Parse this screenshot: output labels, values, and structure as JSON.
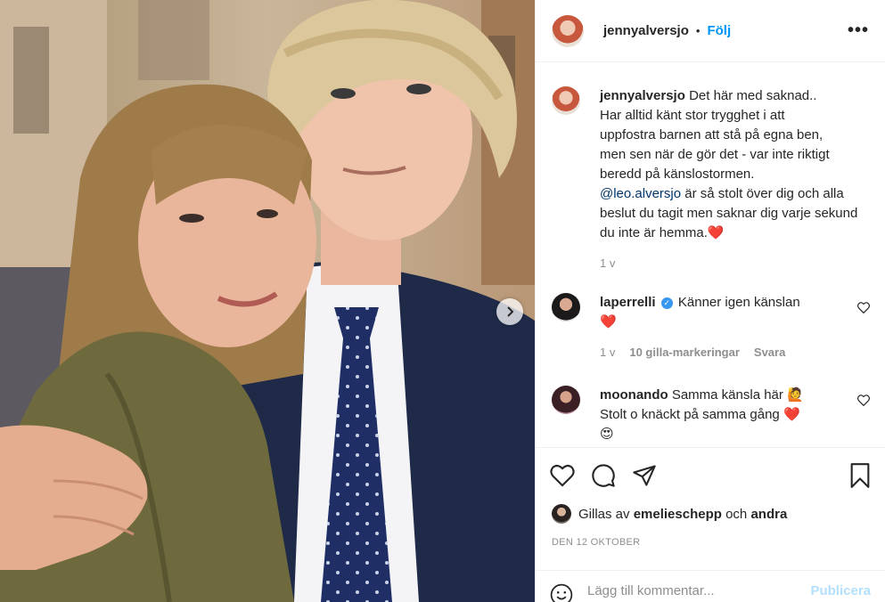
{
  "post": {
    "username": "jennyalversjo",
    "separator": "•",
    "follow_label": "Följ",
    "more_label": "•••",
    "caption_lines": [
      "Det här med saknad..",
      "Har alltid känt stor trygghet i att",
      "uppfostra barnen att stå på egna ben,",
      "men sen när de gör det - var inte riktigt",
      "beredd på känslostormen."
    ],
    "mention": "@leo.alversjo",
    "caption_after_mention": " är så stolt över dig och alla beslut du tagit men saknar dig varje sekund du inte är hemma.❤️",
    "time": "1 v"
  },
  "comments": [
    {
      "username": "laperrelli",
      "verified": true,
      "text": "Känner igen känslan",
      "text2": "❤️",
      "time": "1 v",
      "likes": "10 gilla-markeringar",
      "reply_label": "Svara"
    },
    {
      "username": "moonando",
      "text": "Samma känsla här 🙋",
      "text2": "Stolt o knäckt på samma gång ❤️",
      "text3": "😍"
    }
  ],
  "likes": {
    "prefix": "Gillas av ",
    "user": "emelieschepp",
    "middle": " och ",
    "others": "andra"
  },
  "date": "DEN 12 OKTOBER",
  "add_comment": {
    "placeholder": "Lägg till kommentar...",
    "publish_label": "Publicera"
  },
  "colors": {
    "accent": "#0095f6",
    "publish_disabled": "#b2dffc",
    "mention": "#00376b",
    "heart": "#ed4956"
  },
  "icons": [
    "heart-icon",
    "comment-icon",
    "share-icon",
    "bookmark-icon",
    "emoji-icon",
    "chevron-right-icon"
  ]
}
